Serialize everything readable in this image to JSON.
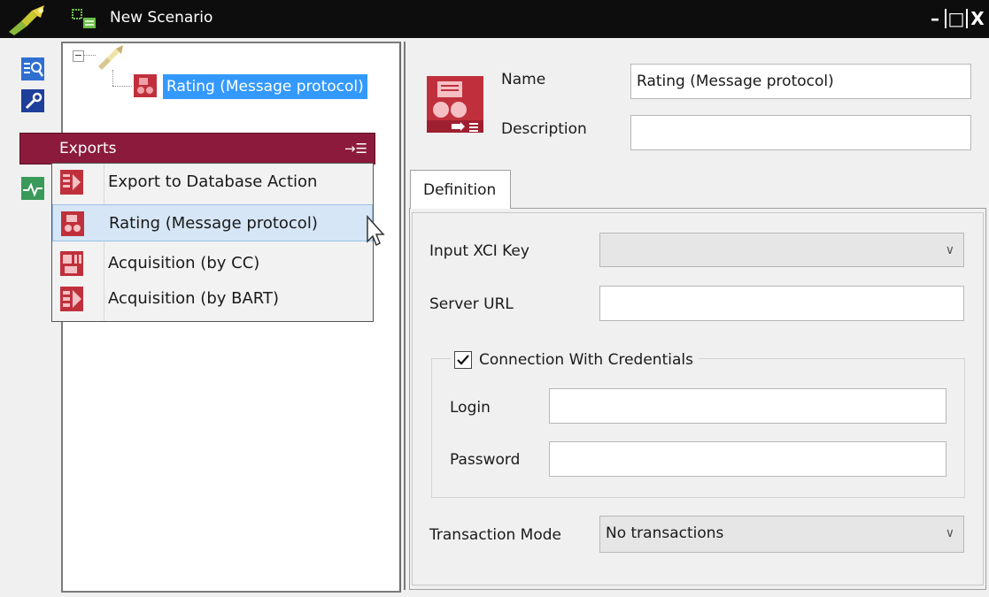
{
  "window": {
    "title": "New Scenario",
    "controls": {
      "minimize": "–",
      "maximize": "□",
      "close": "X"
    }
  },
  "tree": {
    "expander": "⊟",
    "node_label": "Rating (Message protocol)"
  },
  "exports_menu": {
    "title": "Exports",
    "items": [
      {
        "label": "Export to Database Action"
      },
      {
        "label": "Rating (Message protocol)"
      },
      {
        "label": "Acquisition (by CC)"
      },
      {
        "label": "Acquisition (by BART)"
      }
    ]
  },
  "details": {
    "name_label": "Name",
    "name_value": "Rating (Message protocol)",
    "description_label": "Description",
    "description_value": "",
    "tab_label": "Definition",
    "input_xci_key_label": "Input XCI Key",
    "input_xci_key_value": "",
    "server_url_label": "Server URL",
    "server_url_value": "",
    "connection_with_credentials_label": "Connection With Credentials",
    "connection_with_credentials_checked": true,
    "login_label": "Login",
    "login_value": "",
    "password_label": "Password",
    "password_value": "",
    "transaction_mode_label": "Transaction Mode",
    "transaction_mode_value": "No transactions"
  },
  "colors": {
    "titlebar": "#0d0d0d",
    "exports_header": "#8c1a3c",
    "selection": "#3399ff",
    "hover_row": "#d6e6f6",
    "icon_red": "#c0303c"
  }
}
